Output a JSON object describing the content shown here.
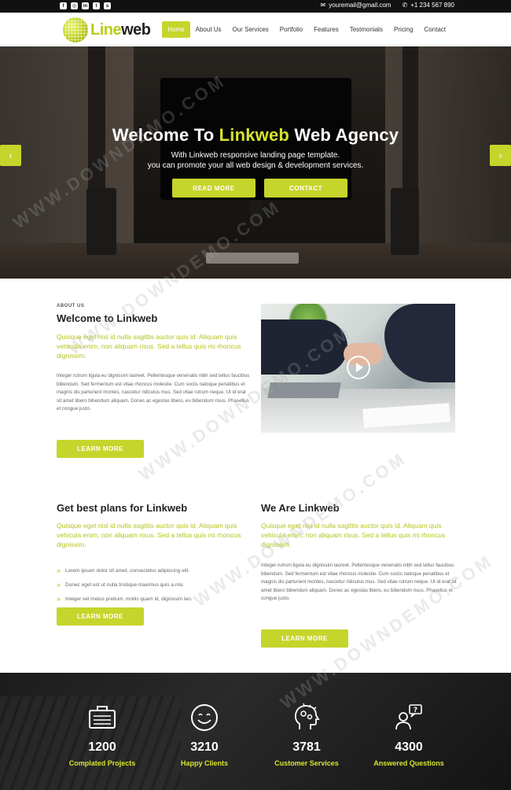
{
  "topbar": {
    "social": [
      {
        "name": "facebook-icon",
        "glyph": "f"
      },
      {
        "name": "instagram-icon",
        "glyph": "◎"
      },
      {
        "name": "linkedin-icon",
        "glyph": "in"
      },
      {
        "name": "twitter-icon",
        "glyph": "t"
      },
      {
        "name": "skype-icon",
        "glyph": "s"
      }
    ],
    "email": "youremail@gmail.com",
    "phone": "+1 234 567 890"
  },
  "brand": {
    "logo_part1": "Line",
    "logo_part2": "web"
  },
  "nav": {
    "items": [
      "Home",
      "About Us",
      "Our Services",
      "Portfolio",
      "Features",
      "Testmonials",
      "Pricing",
      "Contact"
    ],
    "active": "Home"
  },
  "hero": {
    "title_pre": "Welcome To ",
    "title_highlight": "Linkweb",
    "title_post": " Web Agency",
    "subtitle_line1": "With Linkweb responsive landing page template.",
    "subtitle_line2": "you can promote your all web design & development services.",
    "btn_read_more": "READ MORE",
    "btn_contact": "CONTACT",
    "prev_arrow": "‹",
    "next_arrow": "›"
  },
  "about": {
    "label": "ABOUT US",
    "title": "Welcome to Linkweb",
    "lead": "Quisque eget nisl id nulla sagittis auctor quis id. Aliquam quis vehicula enim, non aliquam risus. Sed a tellus quis mi rhoncus dignissim.",
    "body": "Integer rutrum ligula eu dignissim laoreet. Pellentesque venenatis nibh sed tellus faucibus bibendum. Sed fermentum est vitae rhoncus molestie. Cum sociis natoque penatibus et magnis dis parturient montes, nascetur ridiculus mus. Sed vitae rutrum neque. Ut id erat sit amet libero bibendum aliquam. Donec ac egestas libero, eu bibendum risus. Phasellus et congue justo.",
    "button": "LEARN MORE"
  },
  "plans": {
    "title": "Get best plans for Linkweb",
    "lead": "Quisque eget nisl id nulla sagittis auctor quis id. Aliquam quis vehicula enim, non aliquam risus. Sed a tellus quis mi rhoncus dignissim.",
    "bullets": [
      "Lorem ipsum dolor sit amet, consectetur adipiscing elit.",
      "Donec eget est ut nulla tristique maximus quis a nisi.",
      "Integer vel metus pretium, mollis quam id, dignissim leo."
    ],
    "button": "LEARN MORE"
  },
  "we_are": {
    "title": "We Are Linkweb",
    "lead": "Quisque eget nisl id nulla sagittis auctor quis id. Aliquam quis vehicula enim, non aliquam risus. Sed a tellus quis mi rhoncus dignissim.",
    "body": "Integer rutrum ligula eu dignissim laoreet. Pellentesque venenatis nibh sed tellus faucibus bibendum. Sed fermentum est vitae rhoncus molestie. Cum sociis natoque penatibus et magnis dis parturient montes, nascetur ridiculus mus. Sed vitae rutrum neque. Ut id erat sit amet libero bibendum aliquam. Donec ac egestas libero, eu bibendum risus. Phasellus et congue justo.",
    "button": "LEARN MORE"
  },
  "stats": [
    {
      "icon": "briefcase-icon",
      "number": "1200",
      "label": "Complated Projects"
    },
    {
      "icon": "smiley-icon",
      "number": "3210",
      "label": "Happy Clients"
    },
    {
      "icon": "head-gears-icon",
      "number": "3781",
      "label": "Customer Services"
    },
    {
      "icon": "user-question-icon",
      "number": "4300",
      "label": "Answered Questions"
    }
  ],
  "watermark": "WWW.DOWNDEMO.COM",
  "colors": {
    "accent": "#c6d52b",
    "accent_text": "#b5c41c",
    "dark": "#111111"
  }
}
